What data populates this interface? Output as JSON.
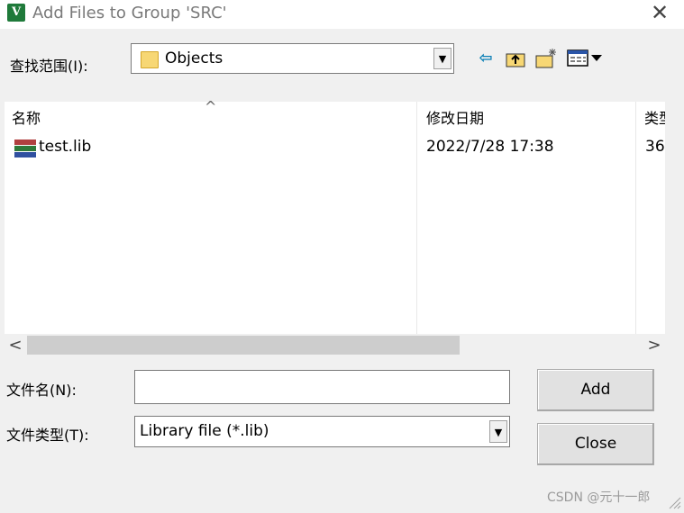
{
  "window": {
    "title": "Add Files to Group 'SRC'",
    "app_icon": "keil-uvision-icon",
    "close_glyph": "✕"
  },
  "look_in": {
    "label": "查找范围(I):",
    "value": "Objects",
    "icon": "folder-icon",
    "dropdown_glyph": "▼"
  },
  "toolbar": {
    "back_icon": "back-arrow-icon",
    "up_icon": "up-folder-icon",
    "new_folder_icon": "new-folder-icon",
    "views_icon": "view-menu-icon"
  },
  "file_list": {
    "columns": [
      "名称",
      "修改日期",
      "类型"
    ],
    "rows": [
      {
        "name": "test.lib",
        "modified": "2022/7/28 17:38",
        "type": "36",
        "icon": "winrar-archive-icon"
      }
    ]
  },
  "scrollbar": {
    "left_glyph": "<",
    "right_glyph": ">"
  },
  "file_name": {
    "label": "文件名(N):",
    "value": ""
  },
  "file_type": {
    "label": "文件类型(T):",
    "value": "Library file (*.lib)"
  },
  "buttons": {
    "add": "Add",
    "close": "Close"
  },
  "watermark": "CSDN @元十一郎",
  "colors": {
    "background": "#f0f0f0",
    "list_background": "#ffffff",
    "back_arrow": "#0a7fb5",
    "title_text": "#7a7a7a"
  }
}
